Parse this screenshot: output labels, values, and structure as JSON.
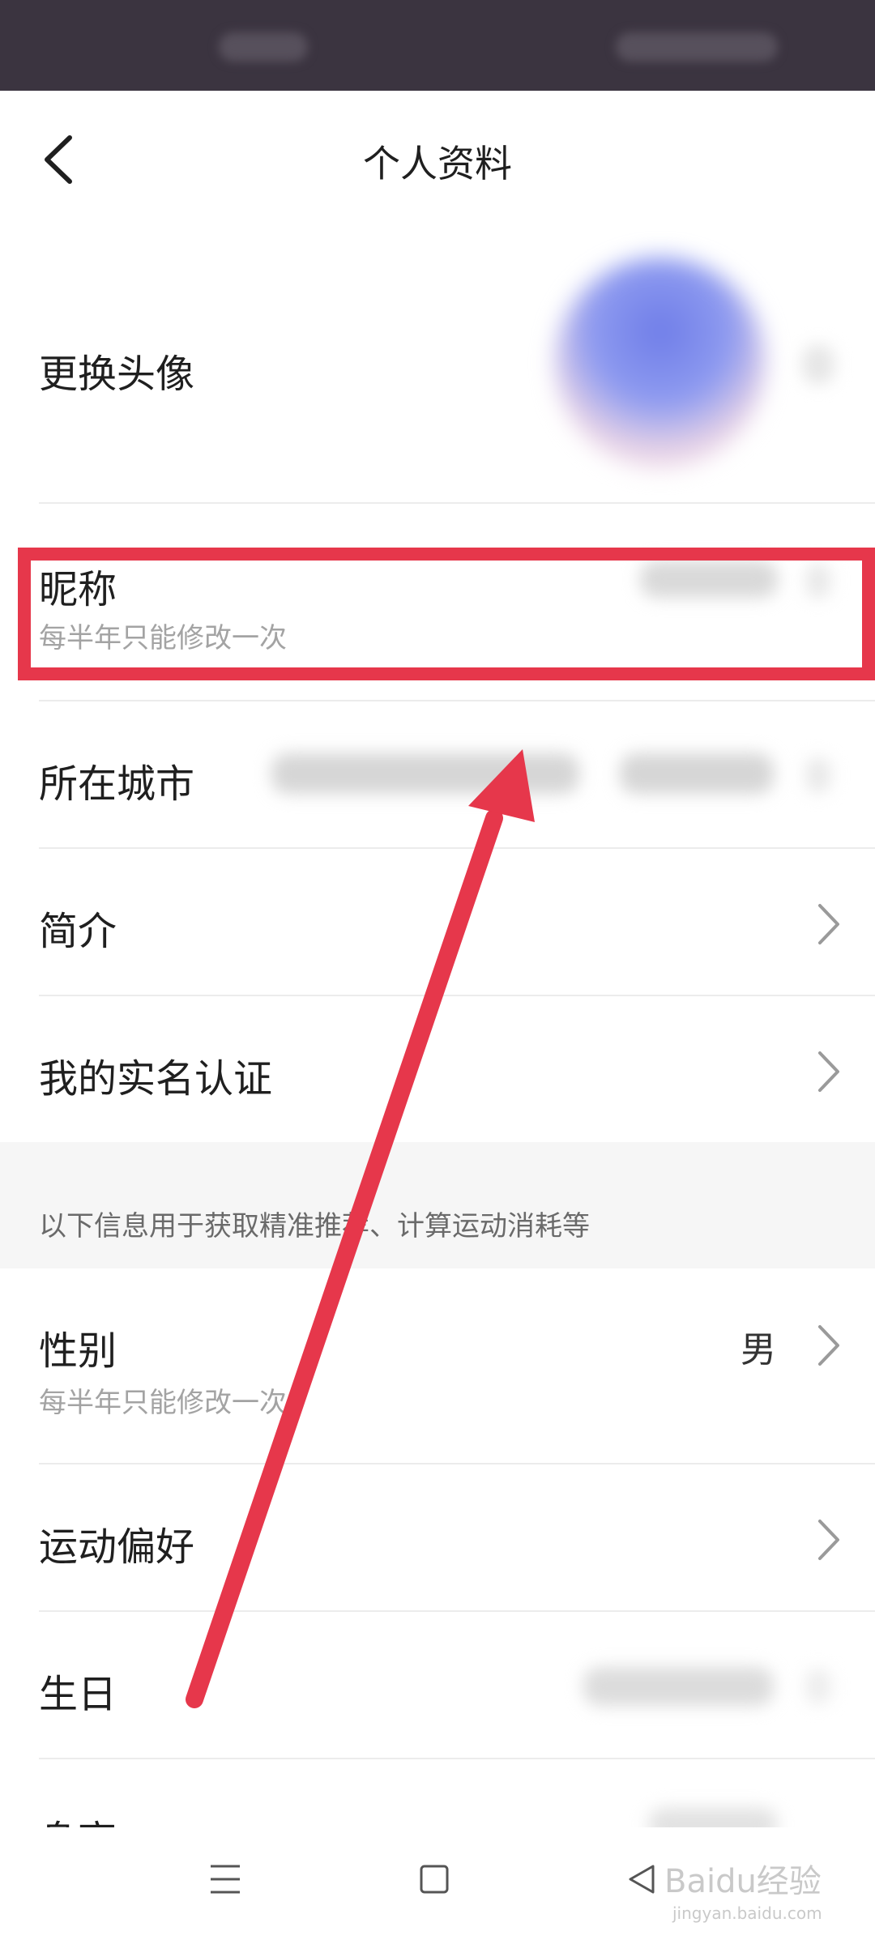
{
  "header": {
    "title": "个人资料"
  },
  "rows": {
    "avatar": {
      "label": "更换头像"
    },
    "nickname": {
      "label": "昵称",
      "sub": "每半年只能修改一次"
    },
    "city": {
      "label": "所在城市"
    },
    "bio": {
      "label": "简介"
    },
    "realname": {
      "label": "我的实名认证"
    },
    "gender": {
      "label": "性别",
      "sub": "每半年只能修改一次",
      "value": "男"
    },
    "sport": {
      "label": "运动偏好"
    },
    "birthday": {
      "label": "生日"
    },
    "height": {
      "label": "身高"
    }
  },
  "section": {
    "note": "以下信息用于获取精准推荐、计算运动消耗等"
  },
  "annotation": {
    "highlight_color": "#e6374b"
  },
  "watermark": {
    "brand": "Baidu经验",
    "url": "jingyan.baidu.com"
  }
}
